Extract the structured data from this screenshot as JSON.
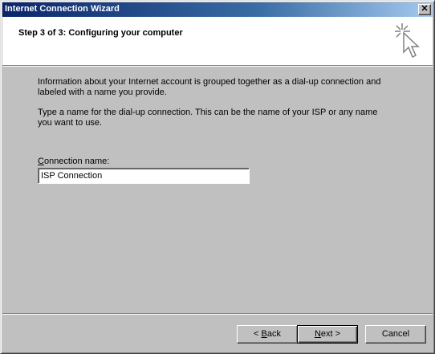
{
  "window": {
    "title": "Internet Connection Wizard",
    "close_glyph": "✕"
  },
  "header": {
    "step_title": "Step 3 of 3: Configuring your computer",
    "icon": "wizard-cursor-icon"
  },
  "body": {
    "paragraph1": "Information about your Internet account is grouped together as a dial-up connection and labeled with a name you provide.",
    "paragraph2": "Type a name for the dial-up connection. This can be the name of your ISP or any name you want to use.",
    "connection_label_accel": "C",
    "connection_label_rest": "onnection name:",
    "connection_name_value": "ISP Connection"
  },
  "buttons": {
    "back_prefix": "< ",
    "back_accel": "B",
    "back_rest": "ack",
    "next_accel": "N",
    "next_suffix": "ext >",
    "cancel_label": "Cancel"
  }
}
